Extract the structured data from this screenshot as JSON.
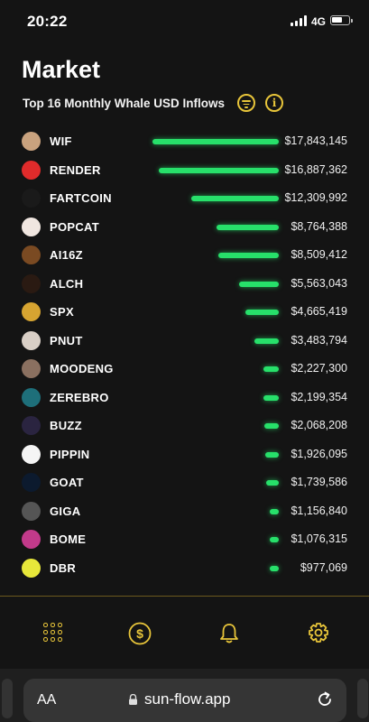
{
  "status_bar": {
    "time": "20:22",
    "network": "4G"
  },
  "page": {
    "title": "Market",
    "subtitle": "Top 16 Monthly Whale USD Inflows"
  },
  "colors": {
    "accent": "#e8c53a",
    "bar": "#27e06a",
    "background": "#141414"
  },
  "header_icons": [
    "filter-icon",
    "info-icon"
  ],
  "coins": [
    {
      "name": "WIF",
      "amount": "$17,843,145",
      "value": 17843145,
      "icon_bg": "#c9a27e"
    },
    {
      "name": "RENDER",
      "amount": "$16,887,362",
      "value": 16887362,
      "icon_bg": "#e02b2b"
    },
    {
      "name": "FARTCOIN",
      "amount": "$12,309,992",
      "value": 12309992,
      "icon_bg": "#1a1a1a"
    },
    {
      "name": "POPCAT",
      "amount": "$8,764,388",
      "value": 8764388,
      "icon_bg": "#f0e6e0"
    },
    {
      "name": "AI16Z",
      "amount": "$8,509,412",
      "value": 8509412,
      "icon_bg": "#7a4a22"
    },
    {
      "name": "ALCH",
      "amount": "$5,563,043",
      "value": 5563043,
      "icon_bg": "#2a1a12"
    },
    {
      "name": "SPX",
      "amount": "$4,665,419",
      "value": 4665419,
      "icon_bg": "#d6a431"
    },
    {
      "name": "PNUT",
      "amount": "$3,483,794",
      "value": 3483794,
      "icon_bg": "#d9cfc6"
    },
    {
      "name": "MOODENG",
      "amount": "$2,227,300",
      "value": 2227300,
      "icon_bg": "#8a7060"
    },
    {
      "name": "ZEREBRO",
      "amount": "$2,199,354",
      "value": 2199354,
      "icon_bg": "#1e6f7a"
    },
    {
      "name": "BUZZ",
      "amount": "$2,068,208",
      "value": 2068208,
      "icon_bg": "#2a2440"
    },
    {
      "name": "PIPPIN",
      "amount": "$1,926,095",
      "value": 1926095,
      "icon_bg": "#f5f5f5"
    },
    {
      "name": "GOAT",
      "amount": "$1,739,586",
      "value": 1739586,
      "icon_bg": "#0c1a2e"
    },
    {
      "name": "GIGA",
      "amount": "$1,156,840",
      "value": 1156840,
      "icon_bg": "#555555"
    },
    {
      "name": "BOME",
      "amount": "$1,076,315",
      "value": 1076315,
      "icon_bg": "#c23a8a"
    },
    {
      "name": "DBR",
      "amount": "$977,069",
      "value": 977069,
      "icon_bg": "#e7e73a"
    }
  ],
  "bottom_nav": [
    {
      "name": "grid-icon",
      "active": true
    },
    {
      "name": "dollar-icon",
      "active": false
    },
    {
      "name": "bell-icon",
      "active": false
    },
    {
      "name": "gear-icon",
      "active": false
    }
  ],
  "browser": {
    "text_size_label": "AA",
    "url": "sun-flow.app"
  }
}
